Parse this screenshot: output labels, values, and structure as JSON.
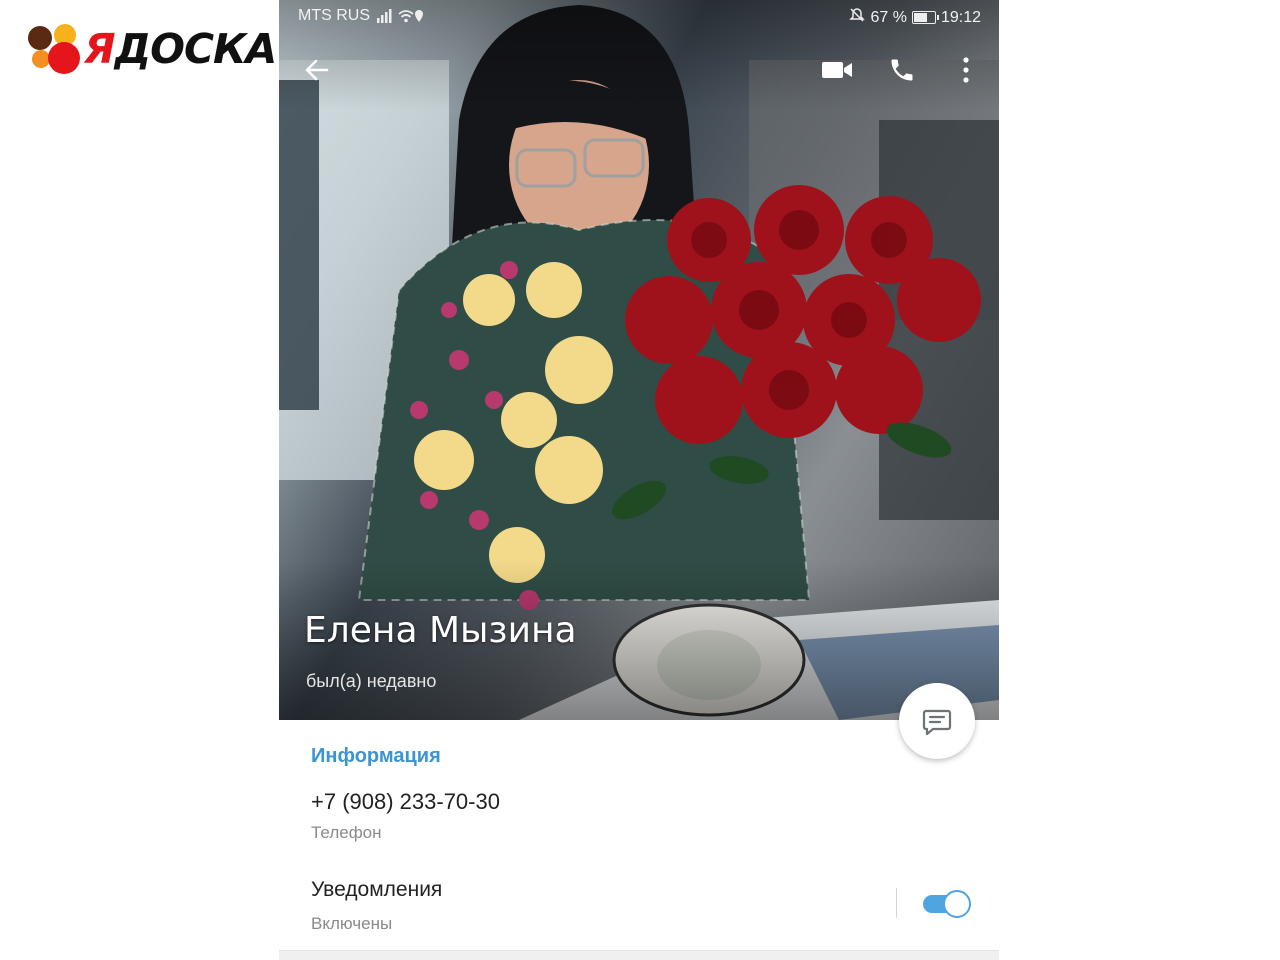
{
  "watermark": {
    "text_first": "Я",
    "text_rest": "ДОСКА",
    "colors": {
      "brown": "#5b2a12",
      "yellow": "#f7b21b",
      "orange": "#f49023",
      "red": "#e4161b"
    }
  },
  "status_bar": {
    "carrier": "MTS RUS",
    "battery": "67 %",
    "battery_level": 0.67,
    "time": "19:12",
    "icons": [
      "signal-icon",
      "wifi-icon",
      "location-icon",
      "mute-icon",
      "battery-icon"
    ]
  },
  "toolbar": {
    "icons": [
      "back-arrow-icon",
      "video-call-icon",
      "phone-icon",
      "more-vert-icon"
    ]
  },
  "profile": {
    "name": "Елена Мызина",
    "status": "был(а) недавно"
  },
  "info": {
    "section_title": "Информация",
    "phone_value": "+7 (908) 233-70-30",
    "phone_label": "Телефон"
  },
  "notifications": {
    "title": "Уведомления",
    "state": "Включены",
    "enabled": true
  },
  "colors": {
    "accent": "#3a95d5",
    "toggle": "#4fa5e0"
  }
}
